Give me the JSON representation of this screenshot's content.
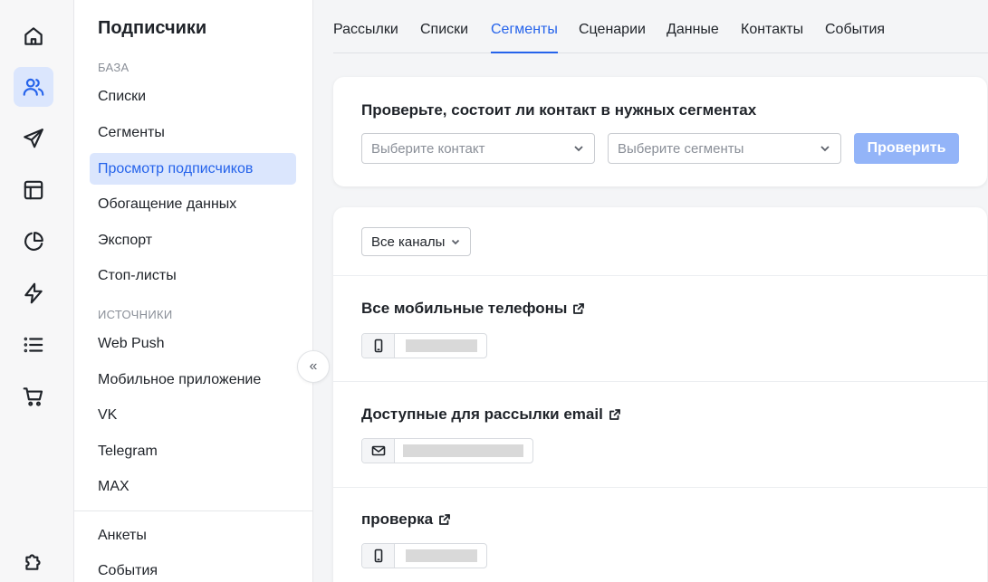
{
  "sidebar": {
    "title": "Подписчики",
    "section_base": "БАЗА",
    "section_sources": "ИСТОЧНИКИ",
    "items": [
      {
        "label": "Списки"
      },
      {
        "label": "Сегменты"
      },
      {
        "label": "Просмотр подписчиков"
      },
      {
        "label": "Обогащение данных"
      },
      {
        "label": "Экспорт"
      },
      {
        "label": "Стоп-листы"
      },
      {
        "label": "Web Push"
      },
      {
        "label": "Мобильное приложение"
      },
      {
        "label": "VK"
      },
      {
        "label": "Telegram"
      },
      {
        "label": "MAX"
      },
      {
        "label": "Анкеты"
      },
      {
        "label": "События"
      }
    ],
    "collapse_glyph": "«"
  },
  "rail": [
    "home-icon",
    "users-icon",
    "send-icon",
    "layout-icon",
    "pie-chart-icon",
    "lightning-icon",
    "list-icon",
    "cart-icon",
    "puzzle-icon"
  ],
  "tabs": [
    "Рассылки",
    "Списки",
    "Сегменты",
    "Сценарии",
    "Данные",
    "Контакты",
    "События"
  ],
  "check": {
    "title": "Проверьте, состоит ли контакт в нужных сегментах",
    "contact_placeholder": "Выберите контакт",
    "segments_placeholder": "Выберите сегменты",
    "button": "Проверить"
  },
  "segments": {
    "channel_filter": "Все каналы",
    "list": [
      {
        "name": "Все мобильные телефоны",
        "channel_icon": "phone-icon"
      },
      {
        "name": "Доступные для рассылки email",
        "channel_icon": "mail-icon"
      },
      {
        "name": "проверка",
        "channel_icon": "phone-icon"
      }
    ]
  },
  "colors": {
    "accent": "#2563eb",
    "accent_light": "#dbe6fd",
    "button_disabled": "#93b4f8"
  }
}
